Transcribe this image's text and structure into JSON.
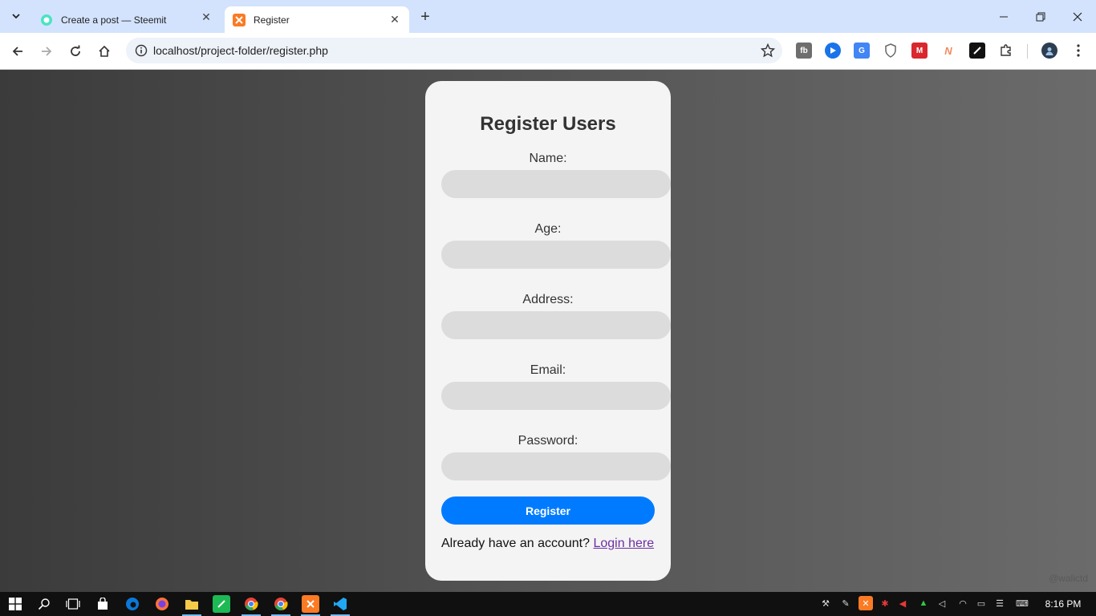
{
  "browser": {
    "tabs": [
      {
        "title": "Create a post — Steemit",
        "active": false,
        "favicon": "steemit-icon"
      },
      {
        "title": "Register",
        "active": true,
        "favicon": "xampp-icon"
      }
    ],
    "new_tab_label": "+",
    "url": "localhost/project-folder/register.php",
    "extensions": [
      "notebook-icon",
      "media-icon",
      "translate-icon",
      "shield-icon",
      "mega-icon",
      "n-icon",
      "pen-icon",
      "puzzle-icon"
    ]
  },
  "form": {
    "title": "Register Users",
    "fields": [
      {
        "label": "Name:",
        "value": "",
        "type": "text"
      },
      {
        "label": "Age:",
        "value": "",
        "type": "text"
      },
      {
        "label": "Address:",
        "value": "",
        "type": "text"
      },
      {
        "label": "Email:",
        "value": "",
        "type": "email"
      },
      {
        "label": "Password:",
        "value": "",
        "type": "password"
      }
    ],
    "submit_label": "Register",
    "login_prompt": "Already have an account?",
    "login_link": "Login here"
  },
  "watermark": "@walictd",
  "taskbar": {
    "clock": "8:16 PM",
    "apps": [
      "start-icon",
      "search-icon",
      "task-view-icon",
      "store-icon",
      "edge-icon",
      "firefox-icon",
      "file-explorer-icon",
      "green-app-icon",
      "chrome-icon",
      "chrome-alt-icon",
      "xampp-icon",
      "vscode-icon"
    ]
  },
  "colors": {
    "accent": "#007bff",
    "card": "#f4f4f4",
    "input": "#dcdcdc",
    "tabstrip": "#d3e3fd"
  }
}
